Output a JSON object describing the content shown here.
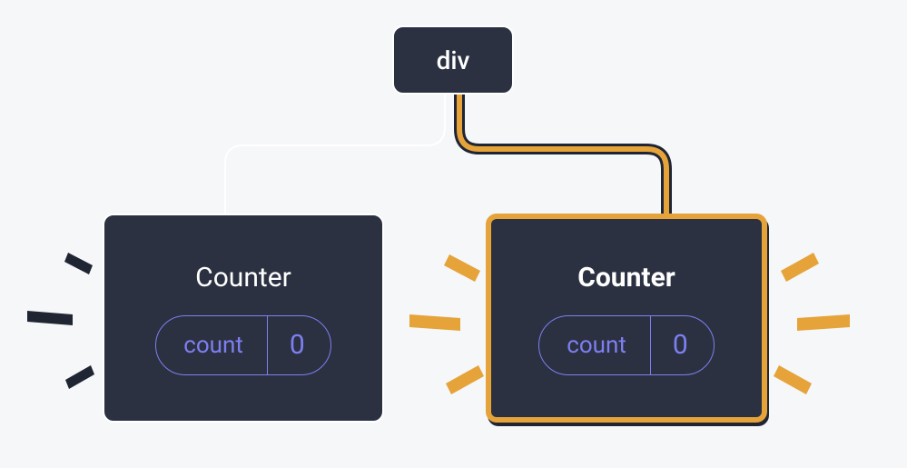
{
  "root": {
    "label": "div"
  },
  "children": [
    {
      "title": "Counter",
      "state_label": "count",
      "state_value": "0",
      "highlighted": false
    },
    {
      "title": "Counter",
      "state_label": "count",
      "state_value": "0",
      "highlighted": true
    }
  ],
  "colors": {
    "node_bg": "#2b3141",
    "node_border": "#ffffff",
    "highlight": "#e5a33a",
    "pill": "#7d7ff0",
    "dark": "#1f2533"
  }
}
